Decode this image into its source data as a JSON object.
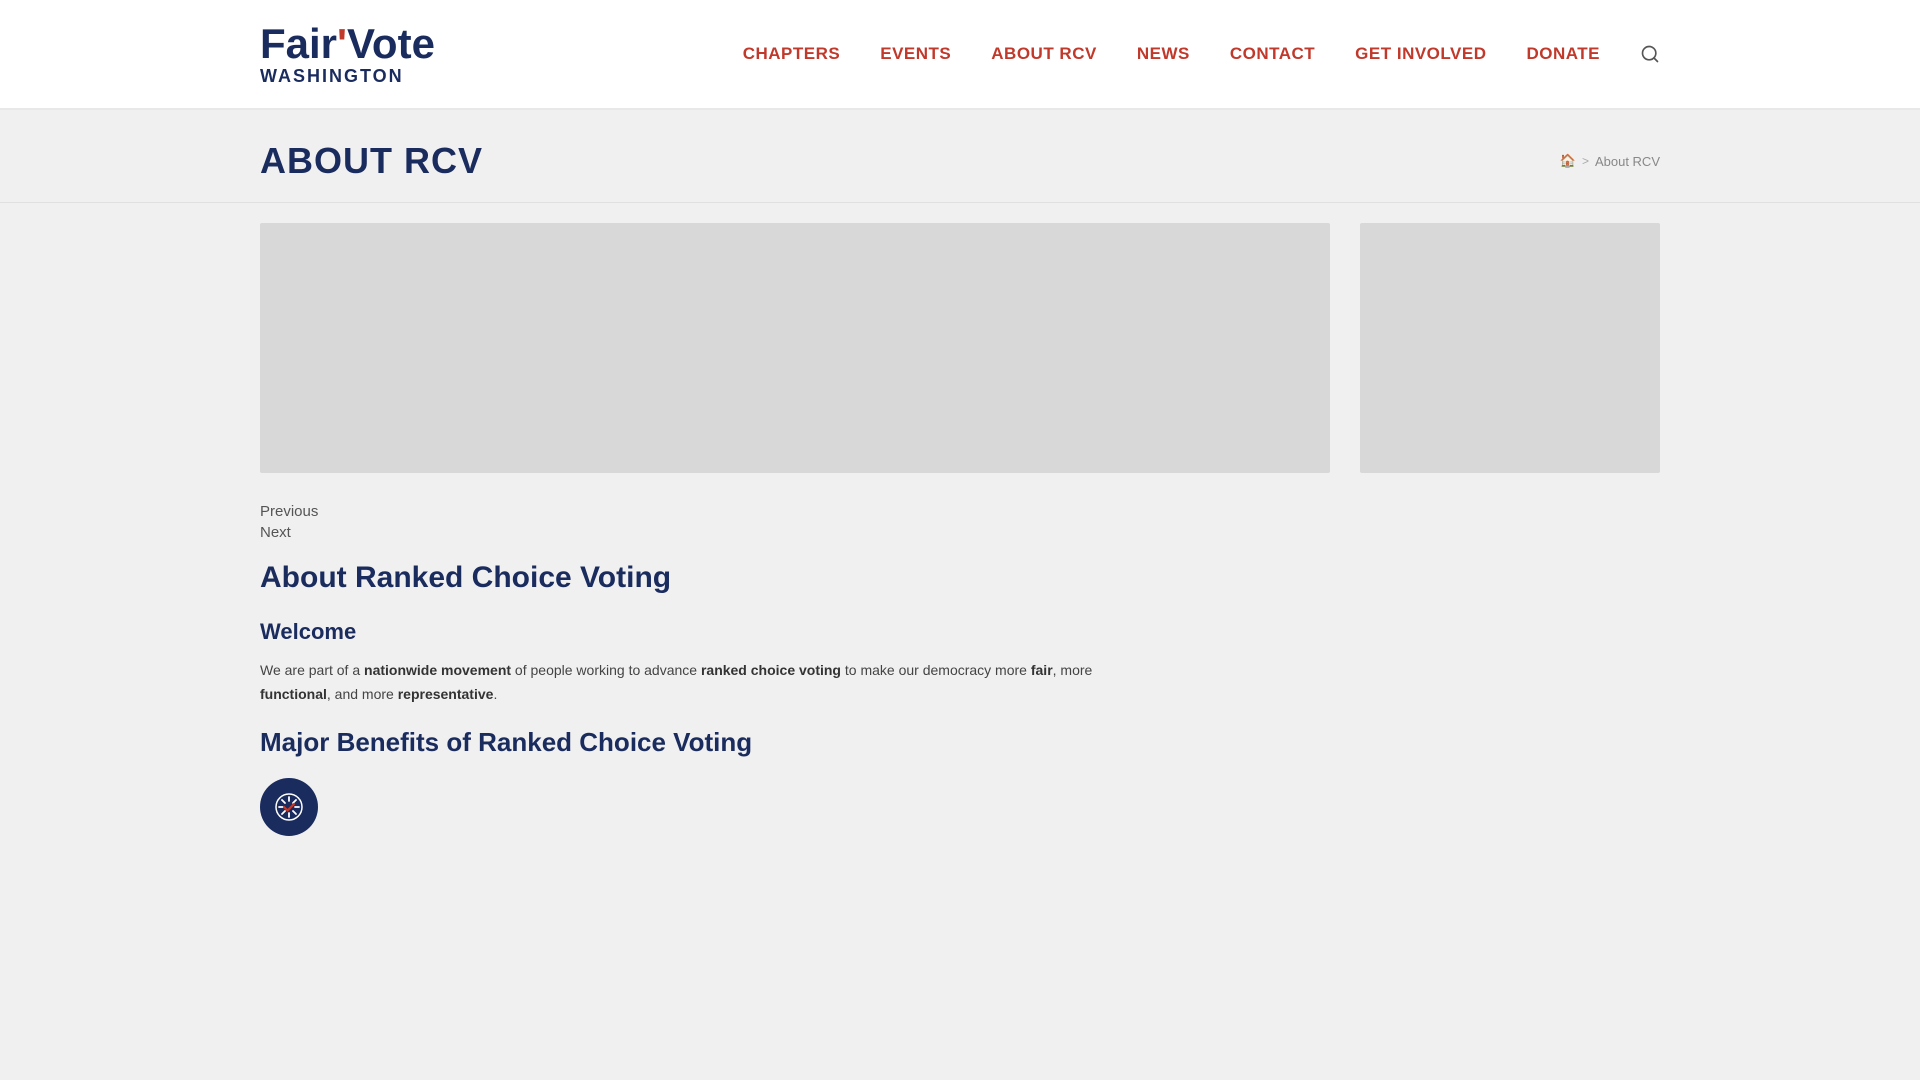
{
  "site": {
    "logo": {
      "fair": "Fair",
      "apostrophe": "'",
      "vote": "Vote",
      "subtitle": "WASHINGTON"
    }
  },
  "nav": {
    "items": [
      {
        "id": "chapters",
        "label": "CHAPTERS"
      },
      {
        "id": "events",
        "label": "EVENTS"
      },
      {
        "id": "about-rcv",
        "label": "ABOUT RCV"
      },
      {
        "id": "news",
        "label": "NEWS"
      },
      {
        "id": "contact",
        "label": "CONTACT"
      },
      {
        "id": "get-involved",
        "label": "GET INVOLVED"
      },
      {
        "id": "donate",
        "label": "DONATE"
      }
    ]
  },
  "page": {
    "title": "ABOUT RCV",
    "breadcrumb": {
      "home_icon": "🏠",
      "separator": ">",
      "current": "About RCV"
    }
  },
  "pagination": {
    "previous": "Previous",
    "next": "Next"
  },
  "article": {
    "main_title": "About Ranked Choice Voting",
    "welcome_title": "Welcome",
    "welcome_body_prefix": "We are part of a ",
    "welcome_bold1": "nationwide movement",
    "welcome_body_mid1": " of people working to advance ",
    "welcome_bold2": "ranked choice voting",
    "welcome_body_mid2": " to make our democracy more ",
    "welcome_bold3": "fair",
    "welcome_body_mid3": ", more ",
    "welcome_bold4": "functional",
    "welcome_body_mid4": ", and more ",
    "welcome_bold5": "representative",
    "welcome_body_end": ".",
    "benefits_title": "Major Benefits of Ranked Choice Voting"
  }
}
